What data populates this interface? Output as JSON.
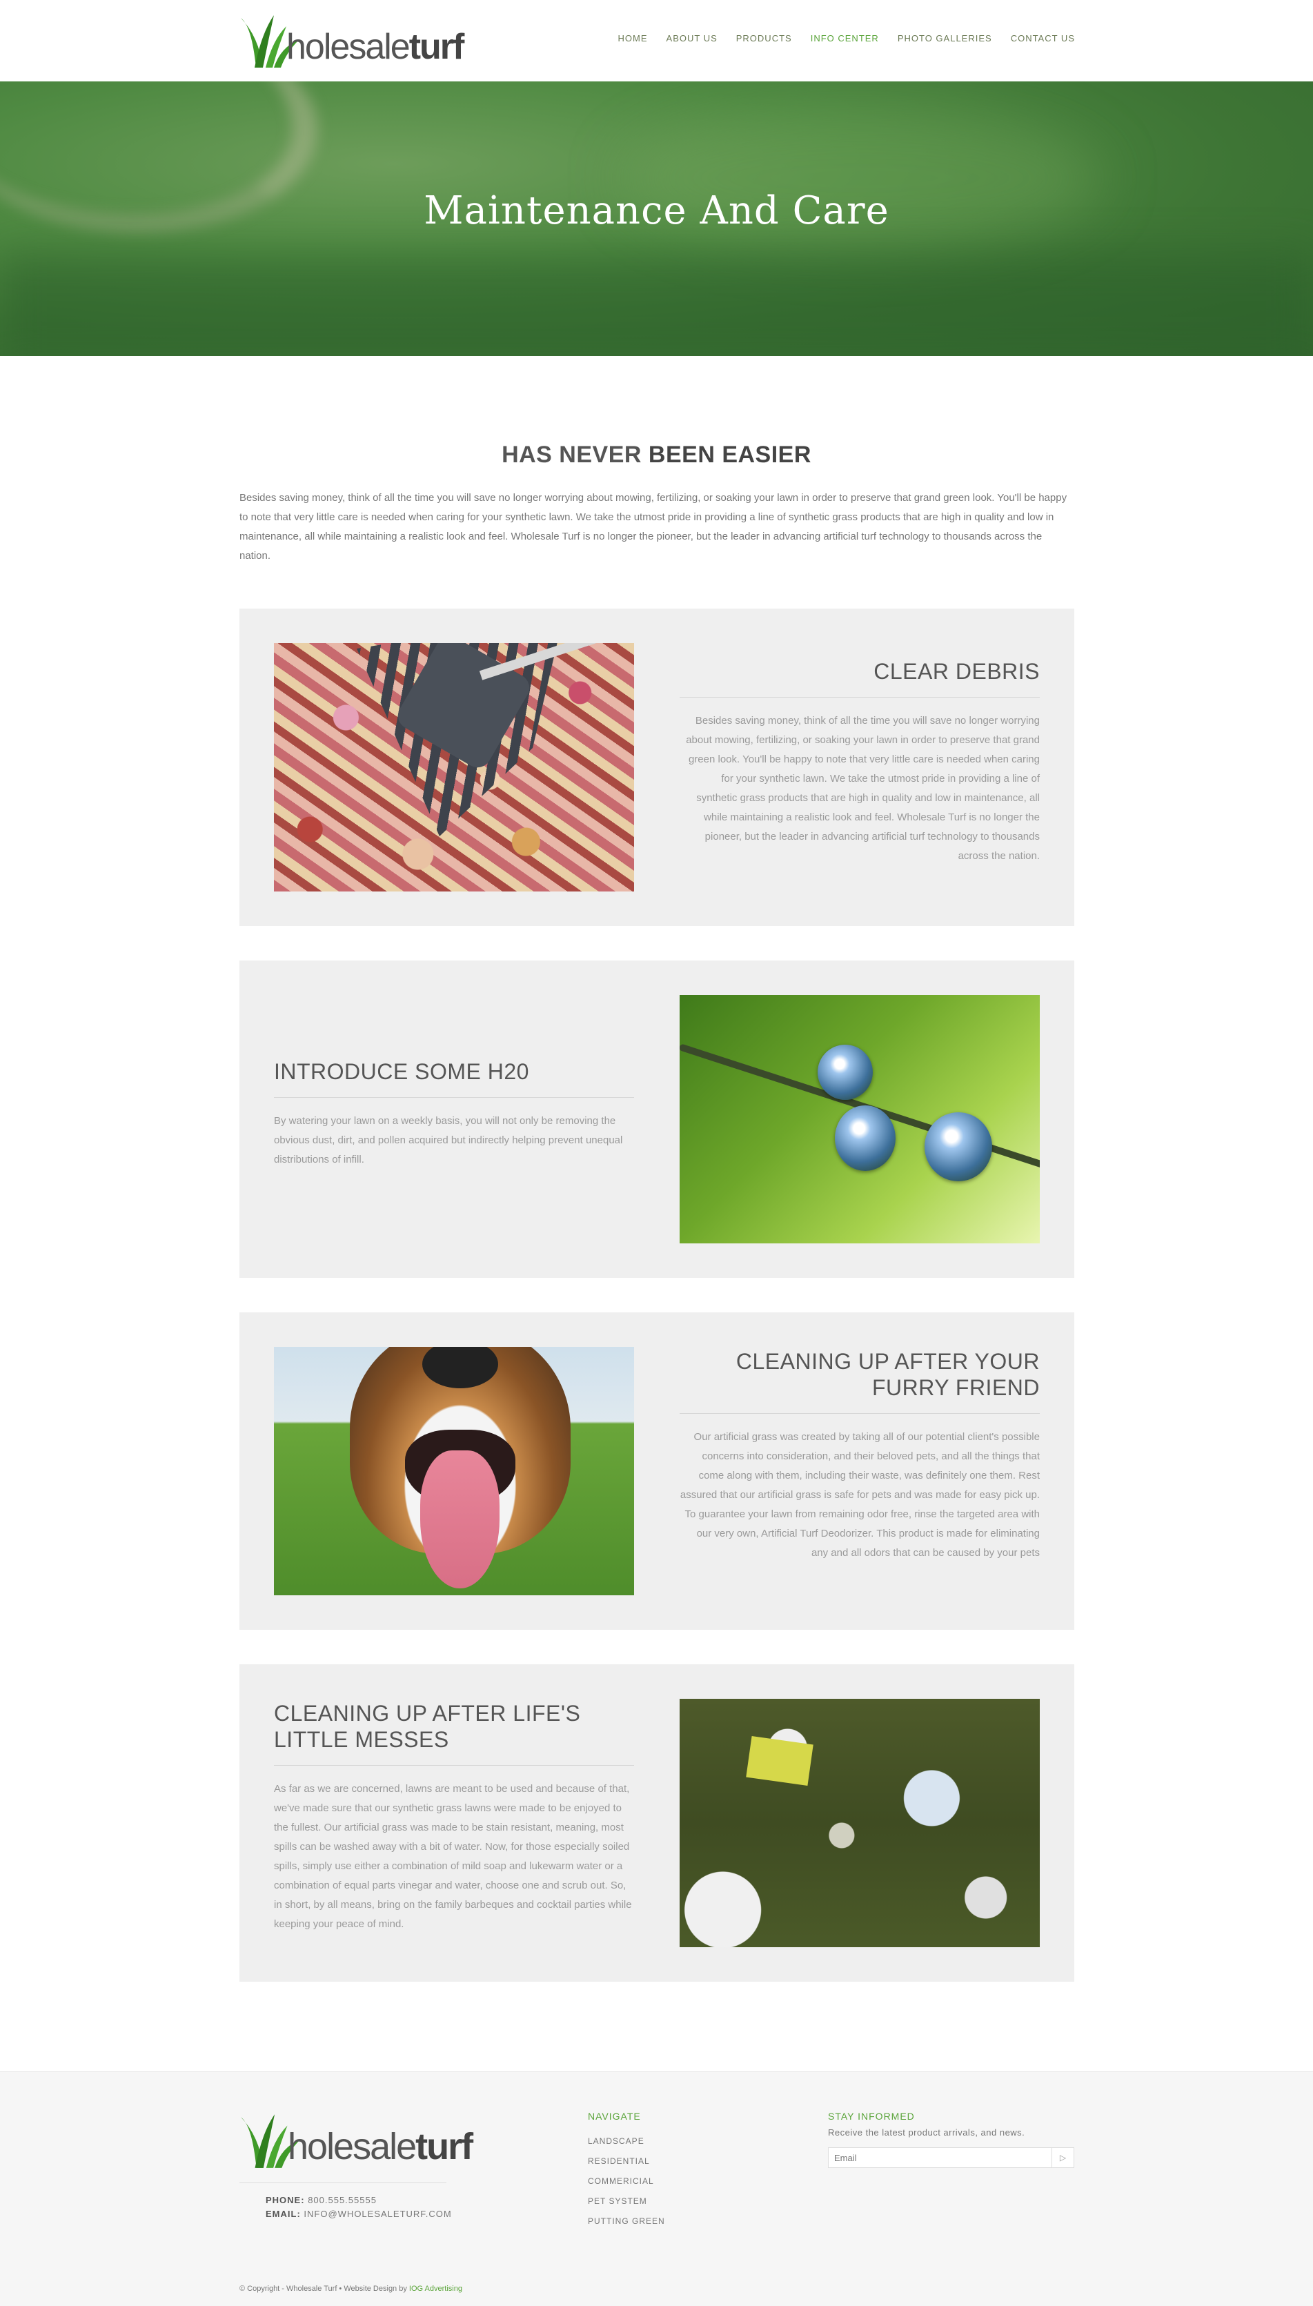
{
  "brand": {
    "logo_text_light": "holesale",
    "logo_text_bold": "turf",
    "accent_green": "#5aa43a",
    "logo_green": "#3f9a28"
  },
  "nav": {
    "items": [
      {
        "label": "HOME",
        "active": false
      },
      {
        "label": "ABOUT US",
        "active": false
      },
      {
        "label": "PRODUCTS",
        "active": false
      },
      {
        "label": "INFO CENTER",
        "active": true
      },
      {
        "label": "PHOTO GALLERIES",
        "active": false
      },
      {
        "label": "CONTACT US",
        "active": false
      }
    ]
  },
  "hero": {
    "title": "Maintenance And Care"
  },
  "intro": {
    "title_light": "HAS NEVER ",
    "title_bold": "BEEN EASIER",
    "text": "Besides saving money, think of all the time you will save no longer worrying about mowing, fertilizing, or soaking your lawn in order to preserve that grand green look. You'll be happy to note that very little care is needed when caring for your synthetic lawn. We take the utmost pride in providing a line of synthetic grass products that are high in quality and low in maintenance, all while maintaining a realistic look and feel. Wholesale Turf is no longer the pioneer, but the leader in advancing artificial turf technology to thousands across the nation."
  },
  "sections": [
    {
      "title": "CLEAR DEBRIS",
      "text": "Besides saving money, think of all the time you will save no longer worrying about mowing, fertilizing, or soaking your lawn in order to preserve that grand green look. You'll be happy to note that very little care is needed when caring for your synthetic lawn. We take the utmost pride in providing a line of synthetic grass products that are high in quality and low in maintenance, all while maintaining a realistic look and feel. Wholesale Turf is no longer the pioneer, but the leader in advancing artificial turf technology to thousands across the nation."
    },
    {
      "title": "INTRODUCE SOME H20",
      "text": "By watering your lawn on a weekly basis, you will not only be removing the obvious dust, dirt, and pollen acquired but indirectly helping prevent unequal distributions of infill."
    },
    {
      "title": "CLEANING UP AFTER YOUR FURRY FRIEND",
      "text": "Our artificial grass was created by taking all of our potential client's possible concerns into consideration, and their beloved pets, and all the things that come along with them, including their waste, was definitely one them. Rest assured that our artificial grass is safe for pets and was made for easy pick up. To guarantee your lawn from remaining odor free, rinse the targeted area with our very own, Artificial Turf Deodorizer. This product is made for eliminating any and all odors that can be caused by your pets"
    },
    {
      "title": "CLEANING UP AFTER LIFE'S LITTLE MESSES",
      "text": "As far as we are concerned, lawns are meant to be used and because of that, we've made sure that our synthetic grass lawns were made to be enjoyed to the fullest. Our artificial grass was made to be stain resistant, meaning, most spills can be washed away with a bit of water. Now, for those especially soiled spills, simply use either a combination of mild soap and lukewarm water or a combination of equal parts vinegar and water, choose one and scrub out. So, in short, by all means, bring on the family barbeques and cocktail parties while keeping your peace of mind."
    }
  ],
  "footer": {
    "phone_label": "PHONE:",
    "phone_value": "800.555.55555",
    "email_label": "EMAIL:",
    "email_value": "INFO@WHOLESALETURF.COM",
    "navigate_heading": "NAVIGATE",
    "navigate_items": [
      "LANDSCAPE",
      "RESIDENTIAL",
      "COMMERICIAL",
      "PET SYSTEM",
      "PUTTING GREEN"
    ],
    "stay_heading": "STAY INFORMED",
    "stay_text": "Receive the latest product arrivals, and news.",
    "email_placeholder": "Email",
    "submit_label": "▷",
    "copyright": "© Copyright - Wholesale Turf • Website Design by ",
    "designer": "IOG Advertising"
  }
}
